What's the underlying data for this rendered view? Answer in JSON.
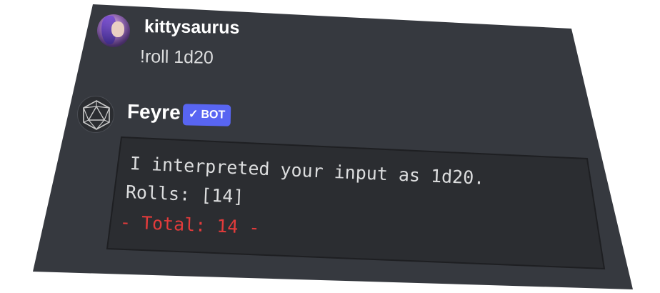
{
  "messages": [
    {
      "author": "kittysaurus",
      "text": "!roll 1d20"
    },
    {
      "author": "Feyre",
      "badge": "BOT",
      "badge_icon": "checkmark-icon",
      "code_lines": [
        "I interpreted your input as 1d20.",
        "Rolls: [14]",
        "- Total: 14 -"
      ]
    }
  ],
  "colors": {
    "background": "#36393f",
    "codeblock": "#2b2d31",
    "badge": "#5865f2",
    "total_text": "#e23b3b",
    "text": "#dcddde"
  }
}
